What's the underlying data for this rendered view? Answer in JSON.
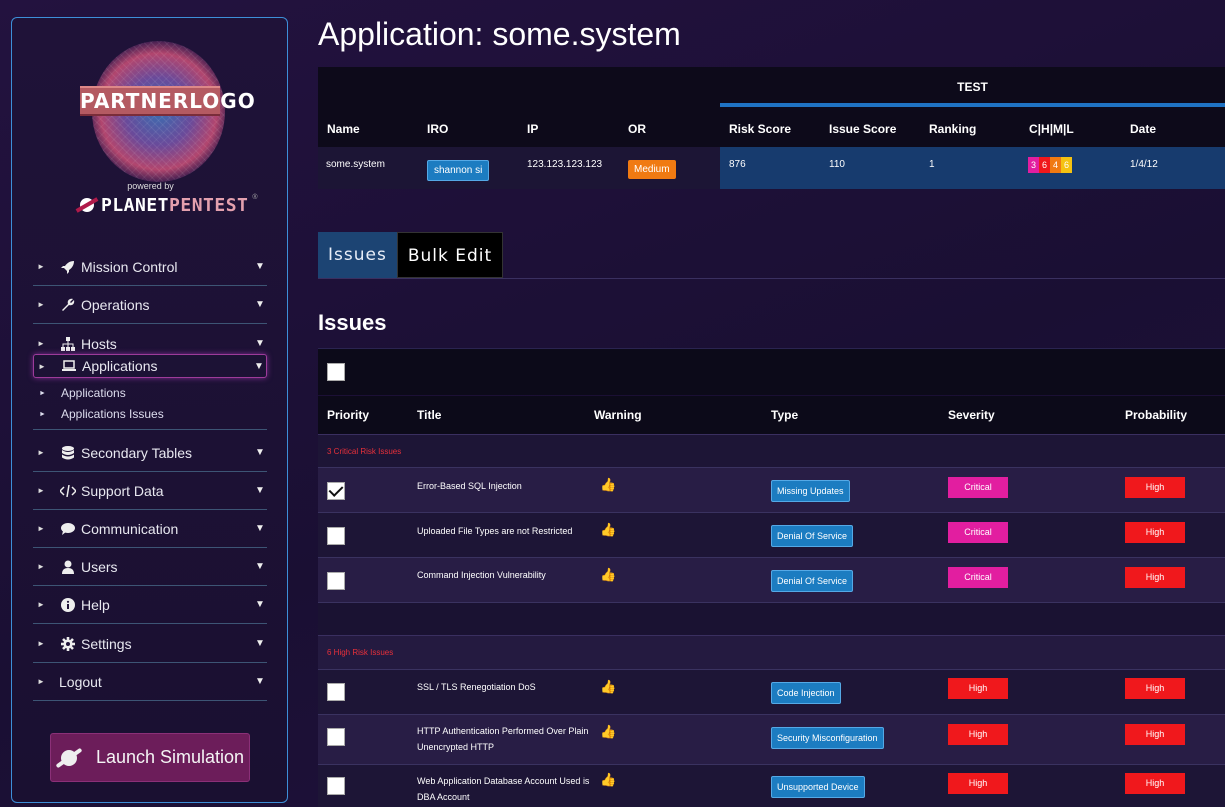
{
  "sidebar": {
    "logo_text": "PARTNERLOGO",
    "powered_by": "powered by",
    "brand_part1": "PLANET",
    "brand_part2": "PENTEST",
    "brand_mark": "®",
    "items": [
      {
        "label": "Mission Control",
        "icon": "rocket-icon"
      },
      {
        "label": "Operations",
        "icon": "wrench-icon"
      },
      {
        "label": "Hosts",
        "icon": "sitemap-icon"
      },
      {
        "label": "Applications",
        "icon": "laptop-icon"
      },
      {
        "label": "Secondary Tables",
        "icon": "database-icon"
      },
      {
        "label": "Support Data",
        "icon": "code-icon"
      },
      {
        "label": "Communication",
        "icon": "chat-icon"
      },
      {
        "label": "Users",
        "icon": "user-icon"
      },
      {
        "label": "Help",
        "icon": "info-icon"
      },
      {
        "label": "Settings",
        "icon": "gear-icon"
      },
      {
        "label": "Logout",
        "icon": ""
      }
    ],
    "sub_items": [
      "Applications",
      "Applications Issues"
    ],
    "launch_label": "Launch Simulation"
  },
  "page": {
    "title": "Application: some.system"
  },
  "app_table": {
    "group_header": "TEST",
    "headers": {
      "name": "Name",
      "iro": "IRO",
      "ip": "IP",
      "or": "OR",
      "risk_score": "Risk Score",
      "issue_score": "Issue Score",
      "ranking": "Ranking",
      "chml": "C|H|M|L",
      "date": "Date"
    },
    "row": {
      "name": "some.system",
      "iro": "shannon si",
      "ip": "123.123.123.123",
      "or": "Medium",
      "risk_score": "876",
      "issue_score": "110",
      "ranking": "1",
      "chml": {
        "c": "3",
        "h": "6",
        "m": "4",
        "l": "6"
      },
      "date": "1/4/12"
    },
    "colors": {
      "c": "#e21ea0",
      "h": "#f0181c",
      "m": "#f07a12",
      "l": "#f5c211"
    }
  },
  "tabs": [
    {
      "label": "Issues",
      "active": true
    },
    {
      "label": "Bulk Edit",
      "active": false
    }
  ],
  "issues": {
    "heading": "Issues",
    "headers": {
      "priority": "Priority",
      "title": "Title",
      "warning": "Warning",
      "type": "Type",
      "severity": "Severity",
      "probability": "Probability"
    },
    "groups": [
      {
        "label": "3 Critical Risk Issues",
        "rows": [
          {
            "title": "Error-Based SQL Injection",
            "type": "Missing Updates",
            "severity": "Critical",
            "probability": "High",
            "checked": true
          },
          {
            "title": "Uploaded File Types are not Restricted",
            "type": "Denial Of Service",
            "severity": "Critical",
            "probability": "High",
            "checked": false
          },
          {
            "title": "Command Injection Vulnerability",
            "type": "Denial Of Service",
            "severity": "Critical",
            "probability": "High",
            "checked": false
          }
        ]
      },
      {
        "label": "6 High Risk Issues",
        "rows": [
          {
            "title": "SSL / TLS Renegotiation DoS",
            "type": "Code Injection",
            "severity": "High",
            "probability": "High",
            "checked": false
          },
          {
            "title": "HTTP Authentication Performed Over Plain Unencrypted HTTP",
            "type": "Security Misconfiguration",
            "severity": "High",
            "probability": "High",
            "checked": false
          },
          {
            "title": "Web Application Database Account Used is DBA Account",
            "type": "Unsupported Device",
            "severity": "High",
            "probability": "High",
            "checked": false
          }
        ]
      }
    ]
  }
}
